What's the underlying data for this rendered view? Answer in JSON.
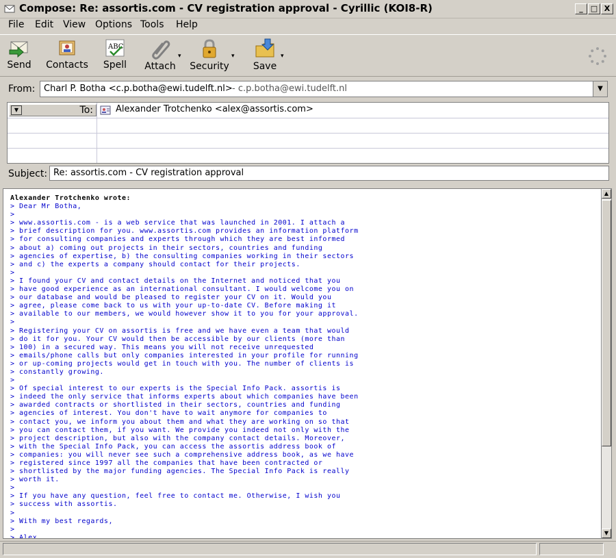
{
  "window": {
    "title": "Compose: Re: assortis.com - CV registration approval  - Cyrillic (KOI8-R)",
    "minimize": "_",
    "maximize": "□",
    "close": "X"
  },
  "menu": [
    "File",
    "Edit",
    "View",
    "Options",
    "Tools",
    "Help"
  ],
  "toolbar": {
    "send": "Send",
    "contacts": "Contacts",
    "spell": "Spell",
    "attach": "Attach",
    "security": "Security",
    "save": "Save",
    "dropdown_glyph": "▾"
  },
  "from": {
    "label": "From:",
    "name": "Charl P. Botha <c.p.botha@ewi.tudelft.nl>",
    "alt": "- c.p.botha@ewi.tudelft.nl"
  },
  "to": {
    "label": "To:",
    "address": "Alexander Trotchenko <alex@assortis.com>"
  },
  "subject": {
    "label": "Subject:",
    "value": "Re: assortis.com - CV registration approval"
  },
  "body": {
    "attribution": "Alexander Trotchenko wrote:",
    "quoted": "> Dear Mr Botha,\n>\n> www.assortis.com - is a web service that was launched in 2001. I attach a\n> brief description for you. www.assortis.com provides an information platform\n> for consulting companies and experts through which they are best informed\n> about a) coming out projects in their sectors, countries and funding\n> agencies of expertise, b) the consulting companies working in their sectors\n> and c) the experts a company should contact for their projects.\n>\n> I found your CV and contact details on the Internet and noticed that you\n> have good experience as an international consultant. I would welcome you on\n> our database and would be pleased to register your CV on it. Would you\n> agree, please come back to us with your up-to-date CV. Before making it\n> available to our members, we would however show it to you for your approval.\n>\n> Registering your CV on assortis is free and we have even a team that would\n> do it for you. Your CV would then be accessible by our clients (more than\n> 100) in a secured way. This means you will not receive unrequested\n> emails/phone calls but only companies interested in your profile for running\n> or up-coming projects would get in touch with you. The number of clients is\n> constantly growing.\n>\n> Of special interest to our experts is the Special Info Pack. assortis is\n> indeed the only service that informs experts about which companies have been\n> awarded contracts or shortlisted in their sectors, countries and funding\n> agencies of interest. You don't have to wait anymore for companies to\n> contact you, we inform you about them and what they are working on so that\n> you can contact them, if you want. We provide you indeed not only with the\n> project description, but also with the company contact details. Moreover,\n> with the Special Info Pack, you can access the assortis address book of\n> companies: you will never see such a comprehensive address book, as we have\n> registered since 1997 all the companies that have been contracted or\n> shortlisted by the major funding agencies. The Special Info Pack is really\n> worth it.\n>\n> If you have any question, feel free to contact me. Otherwise, I wish you\n> success with assortis.\n>\n> With my best regards,\n>\n> Alex"
  },
  "colors": {
    "quoted_text": "#0000cc",
    "window_bg": "#d4d0c8"
  }
}
